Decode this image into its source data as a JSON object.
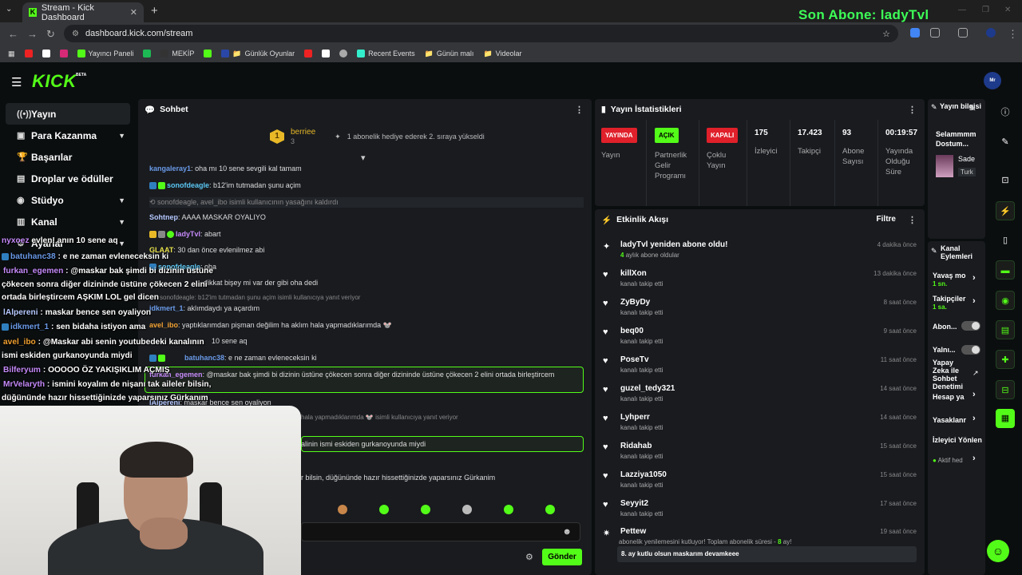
{
  "browser": {
    "tab_title": "Stream - Kick Dashboard",
    "url": "dashboard.kick.com/stream",
    "bookmarks": [
      "Yayıncı Paneli",
      "MEKİP",
      "Günlük Oyunlar",
      "Recent Events",
      "Günün malı",
      "Videolar"
    ]
  },
  "overlay": {
    "last_sub": "Son Abone: ladyTvl"
  },
  "app": {
    "logo": "KICK",
    "logo_badge": "BETA"
  },
  "sidebar": {
    "items": [
      {
        "label": "Yayın",
        "icon": "broadcast-icon"
      },
      {
        "label": "Para Kazanma",
        "icon": "money-icon"
      },
      {
        "label": "Başarılar",
        "icon": "trophy-icon"
      },
      {
        "label": "Droplar ve ödüller",
        "icon": "gift-icon"
      },
      {
        "label": "Stüdyo",
        "icon": "studio-icon"
      },
      {
        "label": "Kanal",
        "icon": "channel-icon"
      },
      {
        "label": "Ayarlar",
        "icon": "gear-icon"
      }
    ]
  },
  "chat": {
    "title": "Sohbet",
    "pinned": {
      "rank": "1",
      "user": "berriee",
      "count": "3",
      "text": "1 abonelik hediye ederek 2. sıraya yükseldi"
    },
    "messages": [
      {
        "user": "kangaleray1",
        "text": "oha mı 10 sene sevgili kal tamam"
      },
      {
        "user": "sonofdeagle",
        "text": "b12'im tutmadan şunu açim"
      },
      {
        "user": "",
        "text": "sonofdeagle, avel_ibo isimli kullanıcının yasağını kaldırdı"
      },
      {
        "user": "Sohtnep",
        "text": "AAAA MASKAR OYALIYO"
      },
      {
        "user": "ladyTvl",
        "text": "abart"
      },
      {
        "user": "GLAAT",
        "text": "30 dan önce evlenilmez abi"
      },
      {
        "user": "sonofdeagle",
        "text": "oha"
      },
      {
        "user": "",
        "text": "dikkat bişey mi var der gibi oha dedi"
      },
      {
        "user": "",
        "text": "sonofdeagle: b12'im tutmadan şunu açim isimli kullanıcıya yanıt veriyor"
      },
      {
        "user": "idkmert_1",
        "text": "aklımdaydı ya açardım"
      },
      {
        "user": "avel_ibo",
        "text": "yaptıklarımdan pişman değilim ha aklım hala yapmadıklarımda 🐭"
      },
      {
        "user": "",
        "text": "10 sene aq"
      },
      {
        "user": "batuhanc38",
        "text": "e ne zaman evleneceksin ki"
      },
      {
        "user": "furkan_egemen",
        "text": "@maskar bak şimdi bi dizinin üstüne çökecen sonra diğer dizininde üstüne çökecen 2 elini ortada birleştircem"
      },
      {
        "user": "lAlpereni",
        "text": "maskar bence sen oyaliyon"
      },
      {
        "user": "",
        "text": "hala yapmadıklarımda 🐭 isimli kullanıcıya yanıt veriyor"
      },
      {
        "user": "",
        "text": "alinin ismi eskiden gurkanoyunda miydi"
      },
      {
        "user": "",
        "text": "r bilsin, düğününde hazır hissettiğinizde yaparsınız Gürkanim"
      }
    ],
    "send_label": "Gönder"
  },
  "overlay_chat": [
    {
      "user": "nyxoez",
      "text": "evlen! anın 10 sene aq"
    },
    {
      "user": "batuhanc38",
      "text": "e ne zaman evleneceksin ki"
    },
    {
      "user": "furkan_egemen",
      "text": "@maskar bak şimdi bi dizinin üstüne"
    },
    {
      "user": "",
      "text": "çökecen sonra diğer dizininde üstüne çökecen 2 elini"
    },
    {
      "user": "",
      "text": "ortada birleştircem AŞKIM LOL gel dicen"
    },
    {
      "user": "lAlpereni",
      "text": "maskar bence sen oyaliyon"
    },
    {
      "user": "idkmert_1",
      "text": "sen bidaha istiyon ama"
    },
    {
      "user": "avel_ibo",
      "text": "@Maskar abi senin youtubedeki kanalının"
    },
    {
      "user": "",
      "text": "ismi eskiden gurkanoyunda miydi"
    },
    {
      "user": "Bilferyum",
      "text": "OOOOO ÖZ YAKIŞIKLIM AÇMIŞ"
    },
    {
      "user": "MrVelaryth",
      "text": "ismini koyalım de nişanı tak aileler bilsin,"
    },
    {
      "user": "",
      "text": "düğününde hazır hissettiğinizde yaparsınız Gürkanım"
    }
  ],
  "stats": {
    "title": "Yayın İstatistikleri",
    "cols": [
      {
        "pill": "YAYINDA",
        "label": "Yayın"
      },
      {
        "pill": "AÇIK",
        "label": "Partnerlik Gelir Programı"
      },
      {
        "pill": "KAPALI",
        "label": "Çoklu Yayın"
      },
      {
        "value": "175",
        "label": "İzleyici"
      },
      {
        "value": "17.423",
        "label": "Takipçi"
      },
      {
        "value": "93",
        "label": "Abone Sayısı"
      },
      {
        "value": "00:19:57",
        "label": "Yayında Olduğu Süre"
      }
    ],
    "colors": {
      "live": "#e0202a",
      "on": "#53fc18",
      "off": "#e0202a"
    }
  },
  "feed": {
    "title": "Etkinlik Akışı",
    "filter": "Filtre",
    "items": [
      {
        "user": "ladyTvl yeniden abone oldu!",
        "sub": "aylık abone oldular",
        "sub_num": "4",
        "time": "4 dakika önce",
        "icon": "sparkle-icon"
      },
      {
        "user": "killXon",
        "sub": "kanalı takip etti",
        "time": "13 dakika önce",
        "icon": "heart-icon"
      },
      {
        "user": "ZyByDy",
        "sub": "kanalı takip etti",
        "time": "8 saat önce",
        "icon": "heart-icon"
      },
      {
        "user": "beq00",
        "sub": "kanalı takip etti",
        "time": "9 saat önce",
        "icon": "heart-icon"
      },
      {
        "user": "PoseTv",
        "sub": "kanalı takip etti",
        "time": "11 saat önce",
        "icon": "heart-icon"
      },
      {
        "user": "guzel_tedy321",
        "sub": "kanalı takip etti",
        "time": "14 saat önce",
        "icon": "heart-icon"
      },
      {
        "user": "Lyhperr",
        "sub": "kanalı takip etti",
        "time": "14 saat önce",
        "icon": "heart-icon"
      },
      {
        "user": "Ridahab",
        "sub": "kanalı takip etti",
        "time": "15 saat önce",
        "icon": "heart-icon"
      },
      {
        "user": "Lazziya1050",
        "sub": "kanalı takip etti",
        "time": "15 saat önce",
        "icon": "heart-icon"
      },
      {
        "user": "Seyyit2",
        "sub": "kanalı takip etti",
        "time": "17 saat önce",
        "icon": "heart-icon"
      }
    ],
    "last": {
      "user": "Pettew",
      "sub": "abonelik yenilemesini kutluyor! Toplam abonelik süresi -",
      "months": "8",
      "unit": "ay!",
      "time": "19 saat önce",
      "message": "8. ay kutlu olsun maskarım devamkeee"
    }
  },
  "info": {
    "title": "Yayın bilgisi",
    "stream_title": "Selammmm Dostum...",
    "category": "Sade",
    "lang": "Turk"
  },
  "actions": {
    "title": "Kanal Eylemleri",
    "items": [
      {
        "label": "Yavaş mo",
        "sub": "1 sn."
      },
      {
        "label": "Takipçiler",
        "sub": "1 sa."
      },
      {
        "label": "Abon..."
      },
      {
        "label": "Yalnı..."
      },
      {
        "label": "Yapay Zeka ile Sohbet Denetimi"
      },
      {
        "label": "Hesap ya"
      },
      {
        "label": "Yasaklanr"
      },
      {
        "label": "İzleyici Yönlen"
      },
      {
        "label": "Aktif hed"
      }
    ]
  }
}
